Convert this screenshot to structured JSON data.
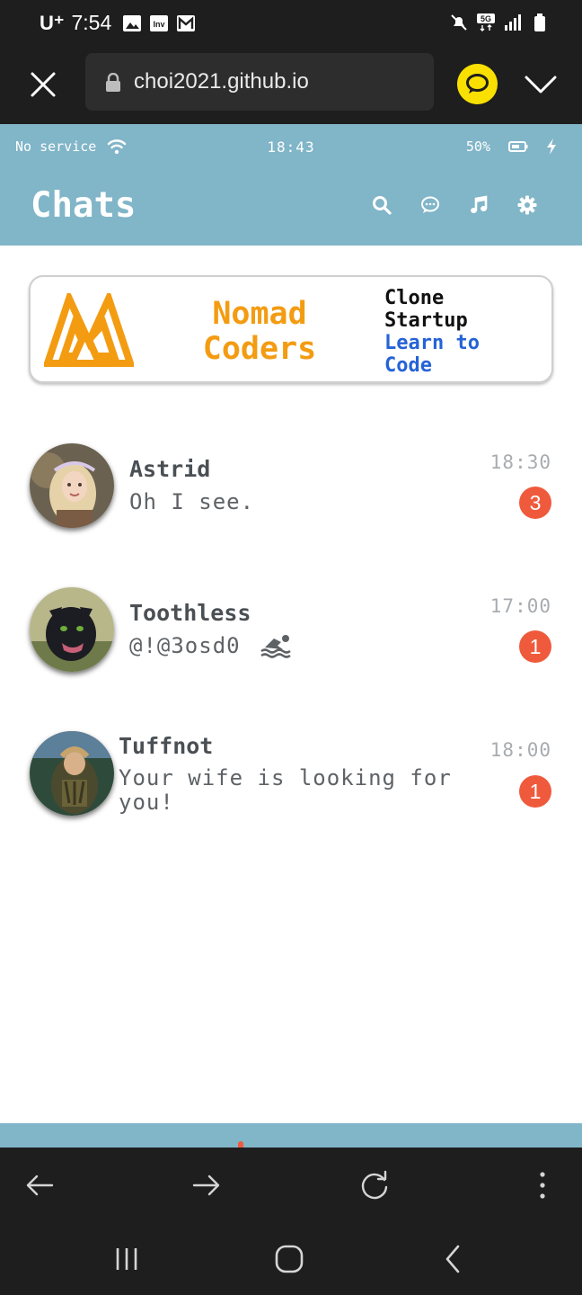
{
  "system_status": {
    "carrier": "U⁺",
    "time": "7:54",
    "icons": [
      "image-icon",
      "inv-icon",
      "gmail-icon",
      "mute-icon",
      "5g-icon",
      "signal-icon",
      "battery-icon"
    ]
  },
  "browser": {
    "url": "choi2021.github.io",
    "close_icon": "close-icon",
    "lock_icon": "lock-icon",
    "kakao_icon": "kakao-talk-icon",
    "menu_icon": "chevron-down-icon",
    "nav": [
      "back-arrow-icon",
      "forward-arrow-icon",
      "reload-icon",
      "more-vertical-icon"
    ]
  },
  "app_status": {
    "service": "No service",
    "time": "18:43",
    "battery": "50%"
  },
  "header": {
    "title": "Chats",
    "icons": [
      "search-icon",
      "chat-bubble-icon",
      "music-icon",
      "gear-icon"
    ]
  },
  "banner": {
    "brand": "Nomad Coders",
    "line1": "Clone Startup",
    "line2": "Learn to Code",
    "colors": {
      "brand": "#f39c12",
      "link": "#2563d6"
    }
  },
  "chats": [
    {
      "name": "Astrid",
      "message": "Oh I see.",
      "time": "18:30",
      "unread": "3"
    },
    {
      "name": "Toothless",
      "message": "@!@3osd0",
      "time": "17:00",
      "unread": "1"
    },
    {
      "name": "Tuffnot",
      "message": "Your wife is looking for you!",
      "time": "18:00",
      "unread": "1"
    }
  ],
  "colors": {
    "accent": "#81b5c8",
    "badge": "#ef5a3c",
    "chrome": "#1e1e1e"
  }
}
